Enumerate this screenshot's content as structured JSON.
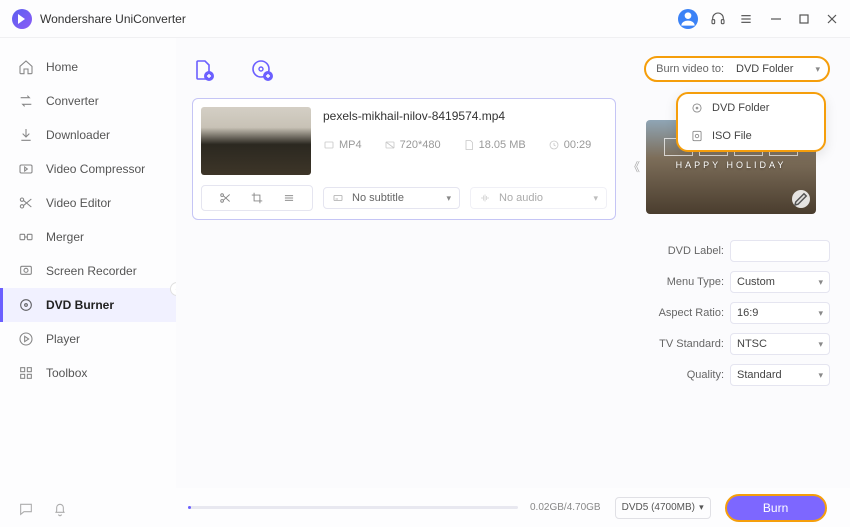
{
  "app": {
    "title": "Wondershare UniConverter"
  },
  "sidebar": {
    "items": [
      {
        "label": "Home"
      },
      {
        "label": "Converter"
      },
      {
        "label": "Downloader"
      },
      {
        "label": "Video Compressor"
      },
      {
        "label": "Video Editor"
      },
      {
        "label": "Merger"
      },
      {
        "label": "Screen Recorder"
      },
      {
        "label": "DVD Burner"
      },
      {
        "label": "Player"
      },
      {
        "label": "Toolbox"
      }
    ]
  },
  "burn_to": {
    "label": "Burn video to:",
    "value": "DVD Folder",
    "options": [
      {
        "label": "DVD Folder"
      },
      {
        "label": "ISO File"
      }
    ]
  },
  "file": {
    "name": "pexels-mikhail-nilov-8419574.mp4",
    "format": "MP4",
    "resolution": "720*480",
    "size": "18.05 MB",
    "duration": "00:29"
  },
  "subtitle": {
    "value": "No subtitle"
  },
  "audio": {
    "value": "No audio"
  },
  "preview": {
    "caption": "HAPPY HOLIDAY"
  },
  "settings": {
    "dvd_label_label": "DVD Label:",
    "dvd_label": "",
    "menu_type_label": "Menu Type:",
    "menu_type": "Custom",
    "aspect_ratio_label": "Aspect Ratio:",
    "aspect_ratio": "16:9",
    "tv_standard_label": "TV Standard:",
    "tv_standard": "NTSC",
    "quality_label": "Quality:",
    "quality": "Standard"
  },
  "bottom": {
    "progress_text": "0.02GB/4.70GB",
    "disk": "DVD5 (4700MB)",
    "burn_label": "Burn"
  }
}
